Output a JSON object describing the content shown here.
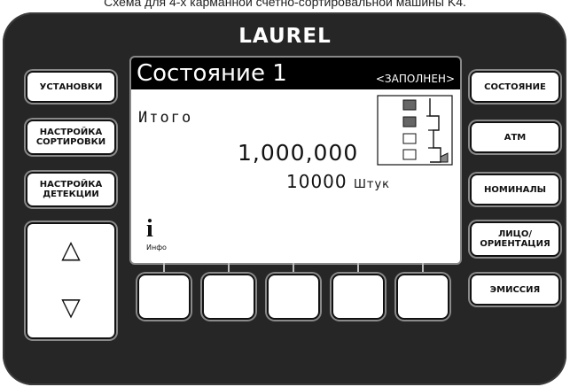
{
  "caption": "Схема для 4-х карманной счетно-сортировальной машины K4.",
  "brand": "LAUREL",
  "left_buttons": [
    {
      "label": "УСТАНОВКИ"
    },
    {
      "label": "НАСТРОЙКА СОРТИРОВКИ"
    },
    {
      "label": "НАСТРОЙКА ДЕТЕКЦИИ"
    }
  ],
  "arrows": {
    "up": "△",
    "down": "▽"
  },
  "right_buttons": [
    {
      "label": "СОСТОЯНИЕ"
    },
    {
      "label": "АТМ"
    },
    {
      "label": "НОМИНАЛЫ"
    },
    {
      "label": "ЛИЦО/ ОРИЕНТАЦИЯ"
    },
    {
      "label": "ЭМИССИЯ"
    }
  ],
  "screen": {
    "title": "Состояние 1",
    "status": "<ЗАПОЛНЕН>",
    "total_label": "Итого",
    "amount": "1,000,000",
    "count": "10000",
    "count_unit": "Штук",
    "info_icon": "i",
    "info_label": "Инфо",
    "pockets": [
      {
        "state": "filled"
      },
      {
        "state": "filled"
      },
      {
        "state": "empty"
      },
      {
        "state": "empty"
      }
    ]
  },
  "softkeys": [
    {
      "id": "f1"
    },
    {
      "id": "f2"
    },
    {
      "id": "f3"
    },
    {
      "id": "f4"
    },
    {
      "id": "f5"
    }
  ],
  "colors": {
    "panel": "#262626",
    "screen_title_bar": "#000000",
    "button_face": "#ffffff"
  }
}
